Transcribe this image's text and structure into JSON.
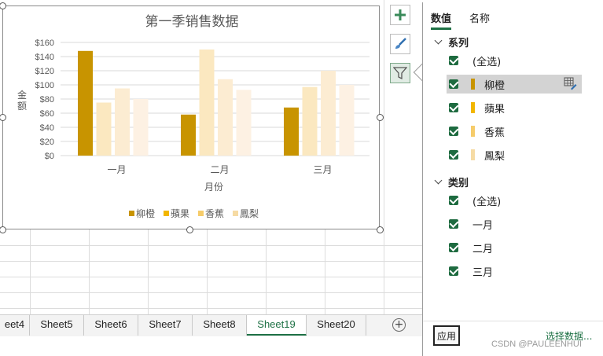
{
  "sheet_tabs": [
    "eet4",
    "Sheet5",
    "Sheet6",
    "Sheet7",
    "Sheet8",
    "Sheet19",
    "Sheet20"
  ],
  "active_tab": "Sheet19",
  "side_buttons": [
    "plus-icon",
    "brush-icon",
    "filter-icon"
  ],
  "panel": {
    "tabs": [
      "数值",
      "名称"
    ],
    "series_heading": "系列",
    "series_items": [
      {
        "label": "(全选)",
        "swatch": null
      },
      {
        "label": "柳橙",
        "swatch": "#c89400",
        "selected": true
      },
      {
        "label": "蘋果",
        "swatch": "#f2b600"
      },
      {
        "label": "香蕉",
        "swatch": "#f6cc6a"
      },
      {
        "label": "鳳梨",
        "swatch": "#f6dba4"
      }
    ],
    "category_heading": "类别",
    "category_items": [
      "(全选)",
      "一月",
      "二月",
      "三月"
    ],
    "apply_label": "应用",
    "select_data_label": "选择数据..."
  },
  "watermark": "CSDN @PAULEENHUI",
  "chart_data": {
    "type": "bar",
    "title": "第一季销售数据",
    "xlabel": "月份",
    "ylabel": "金额",
    "categories": [
      "一月",
      "二月",
      "三月"
    ],
    "ylim": [
      0,
      160
    ],
    "yticks": [
      "$0",
      "$20",
      "$40",
      "$60",
      "$80",
      "$100",
      "$120",
      "$140",
      "$160"
    ],
    "grid": true,
    "legend": "bottom",
    "series": [
      {
        "name": "柳橙",
        "values": [
          148,
          58,
          68
        ],
        "color": "#c89400"
      },
      {
        "name": "蘋果",
        "values": [
          75,
          150,
          97
        ],
        "color": "#fbe8c0"
      },
      {
        "name": "香蕉",
        "values": [
          95,
          108,
          120
        ],
        "color": "#fcecd2"
      },
      {
        "name": "鳳梨",
        "values": [
          80,
          93,
          100
        ],
        "color": "#fdf1e3"
      }
    ]
  }
}
